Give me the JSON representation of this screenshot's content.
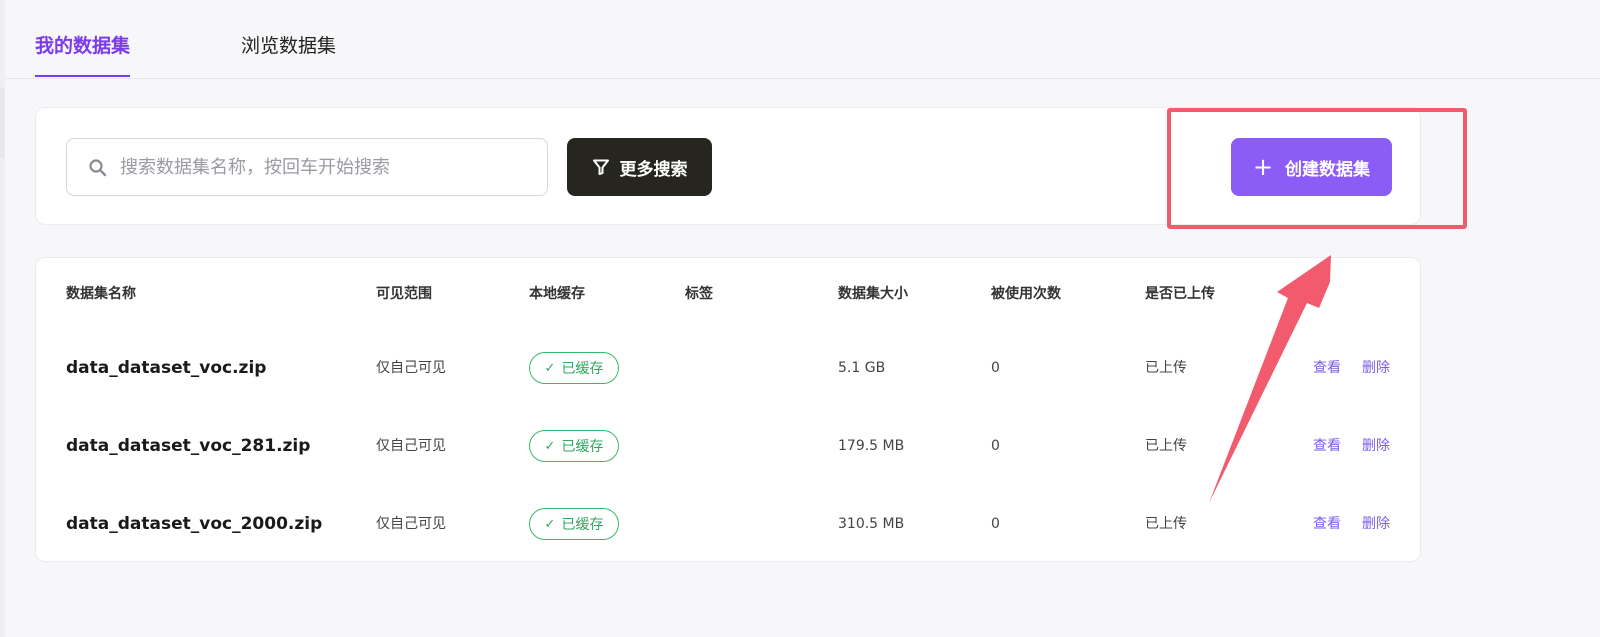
{
  "tabs": [
    {
      "label": "我的数据集",
      "active": true
    },
    {
      "label": "浏览数据集",
      "active": false
    }
  ],
  "search": {
    "placeholder": "搜索数据集名称，按回车开始搜索",
    "value": ""
  },
  "toolbar": {
    "more_search_label": "更多搜索",
    "create_label": "创建数据集"
  },
  "table": {
    "headers": {
      "name": "数据集名称",
      "visibility": "可见范围",
      "cache": "本地缓存",
      "tags": "标签",
      "size": "数据集大小",
      "usage": "被使用次数",
      "uploaded": "是否已上传"
    },
    "rows": [
      {
        "name": "data_dataset_voc.zip",
        "visibility": "仅自己可见",
        "cache": "已缓存",
        "tags": "",
        "size": "5.1 GB",
        "usage": "0",
        "uploaded": "已上传",
        "view": "查看",
        "delete": "删除"
      },
      {
        "name": "data_dataset_voc_281.zip",
        "visibility": "仅自己可见",
        "cache": "已缓存",
        "tags": "",
        "size": "179.5 MB",
        "usage": "0",
        "uploaded": "已上传",
        "view": "查看",
        "delete": "删除"
      },
      {
        "name": "data_dataset_voc_2000.zip",
        "visibility": "仅自己可见",
        "cache": "已缓存",
        "tags": "",
        "size": "310.5 MB",
        "usage": "0",
        "uploaded": "已上传",
        "view": "查看",
        "delete": "删除"
      }
    ]
  },
  "icons": {
    "search": "search-icon",
    "filter": "filter-icon",
    "plus": "plus-icon",
    "check": "check-icon"
  },
  "colors": {
    "accent": "#7c3aed",
    "create_button": "#8b5cf6",
    "dark_button": "#26261f",
    "cached_green": "#2fa860",
    "link": "#7c5ce6",
    "annotation": "#f25a6d"
  }
}
